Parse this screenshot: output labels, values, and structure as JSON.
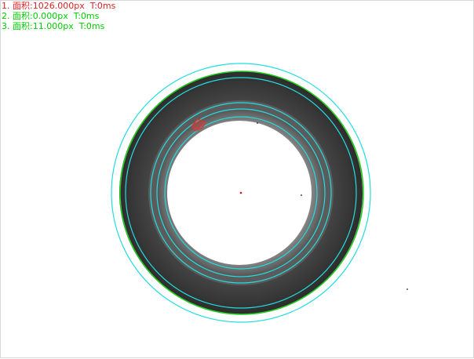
{
  "measurements": [
    {
      "index": "1.",
      "label": "面积:",
      "value": "1026.000px",
      "time": "T:0ms",
      "color": "#e02020"
    },
    {
      "index": "2.",
      "label": "面积:",
      "value": "0.000px",
      "time": "T:0ms",
      "color": "#00cc00"
    },
    {
      "index": "3.",
      "label": "面积:",
      "value": "11.000px",
      "time": "T:0ms",
      "color": "#00cc00"
    }
  ],
  "colors": {
    "background": "#ffffff",
    "ring": "#3a3b3a",
    "cyan_contour": "#22dde0",
    "green_contour": "#22cc22",
    "defect": "#e03030"
  },
  "icons": {
    "inspection_image": "gasket-ring-image",
    "defect_marker": "defect-marker-icon"
  }
}
